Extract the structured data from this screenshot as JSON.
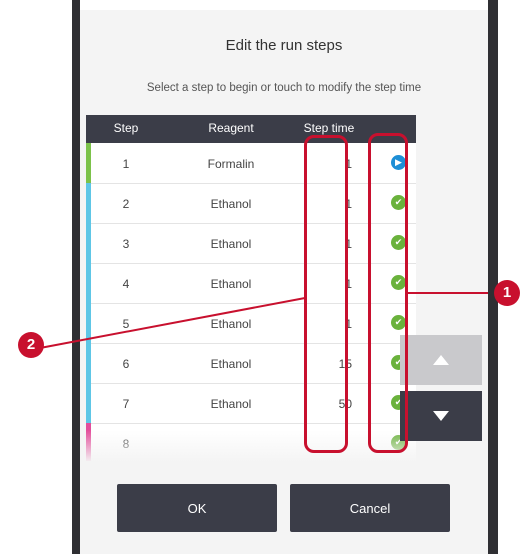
{
  "dialog": {
    "title": "Edit the run steps",
    "subtitle": "Select a step to begin or touch to modify the step time"
  },
  "table": {
    "headers": [
      "Step",
      "Reagent",
      "Step time"
    ],
    "rows": [
      {
        "step": "1",
        "reagent": "Formalin",
        "time": "1",
        "bar_color": "#7cc24a",
        "status": "current"
      },
      {
        "step": "2",
        "reagent": "Ethanol",
        "time": "1",
        "bar_color": "#5ec6e6",
        "status": "ok"
      },
      {
        "step": "3",
        "reagent": "Ethanol",
        "time": "1",
        "bar_color": "#5ec6e6",
        "status": "ok"
      },
      {
        "step": "4",
        "reagent": "Ethanol",
        "time": "1",
        "bar_color": "#5ec6e6",
        "status": "ok"
      },
      {
        "step": "5",
        "reagent": "Ethanol",
        "time": "1",
        "bar_color": "#5ec6e6",
        "status": "ok"
      },
      {
        "step": "6",
        "reagent": "Ethanol",
        "time": "15",
        "bar_color": "#5ec6e6",
        "status": "ok"
      },
      {
        "step": "7",
        "reagent": "Ethanol",
        "time": "50",
        "bar_color": "#5ec6e6",
        "status": "ok"
      },
      {
        "step": "8",
        "reagent": "",
        "time": "",
        "bar_color": "#e34d9b",
        "status": "ok"
      }
    ]
  },
  "icons": {
    "current": "play-circle-icon",
    "ok": "check-circle-icon",
    "scroll_up": "triangle-up-icon",
    "scroll_down": "triangle-down-icon"
  },
  "colors": {
    "current": "#1e8fd6",
    "ok": "#6ab23c",
    "header": "#3b3d48",
    "highlight": "#c8102e"
  },
  "buttons": {
    "ok_label": "OK",
    "cancel_label": "Cancel"
  },
  "callouts": {
    "one": "1",
    "two": "2"
  }
}
